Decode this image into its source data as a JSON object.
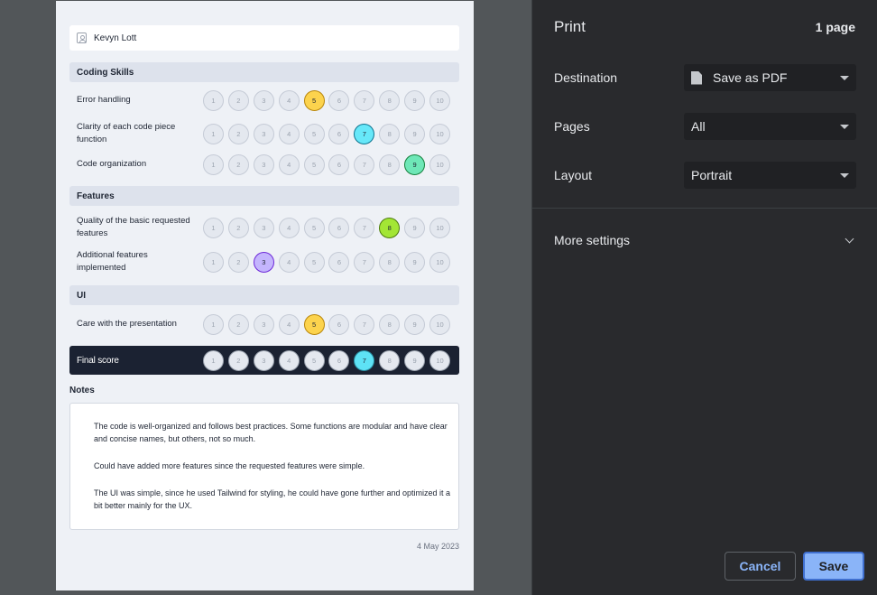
{
  "preview": {
    "candidate_name": "Kevyn Lott",
    "scale": [
      "1",
      "2",
      "3",
      "4",
      "5",
      "6",
      "7",
      "8",
      "9",
      "10"
    ],
    "sections": [
      {
        "title": "Coding Skills",
        "criteria": [
          {
            "label": "Error handling",
            "score": 5,
            "color": "#fcd34d",
            "border": "#b8860b"
          },
          {
            "label": "Clarity of each code piece function",
            "score": 7,
            "color": "#67e8f9",
            "border": "#0e7490"
          },
          {
            "label": "Code organization",
            "score": 9,
            "color": "#6ee7b7",
            "border": "#15803d"
          }
        ]
      },
      {
        "title": "Features",
        "criteria": [
          {
            "label": "Quality of the basic requested features",
            "score": 8,
            "color": "#a3e635",
            "border": "#4d7c0f"
          },
          {
            "label": "Additional features implemented",
            "score": 3,
            "color": "#c4b5fd",
            "border": "#6d28d9"
          }
        ]
      },
      {
        "title": "UI",
        "criteria": [
          {
            "label": "Care with the presentation",
            "score": 5,
            "color": "#fcd34d",
            "border": "#b8860b"
          }
        ]
      }
    ],
    "final": {
      "label": "Final score",
      "score": 7,
      "color": "#5ee2f5"
    },
    "notes_title": "Notes",
    "notes": [
      "The code is well-organized and follows best practices. Some functions are modular and have clear and concise names, but others, not so much.",
      "Could have added more features since the requested features were simple.",
      "The UI was simple, since he used Tailwind for styling, he could have gone further and optimized it a bit better mainly for the UX."
    ],
    "date": "4 May 2023"
  },
  "panel": {
    "title": "Print",
    "page_count": "1 page",
    "destination_label": "Destination",
    "destination_value": "Save as PDF",
    "destination_icon": "document-icon",
    "pages_label": "Pages",
    "pages_value": "All",
    "layout_label": "Layout",
    "layout_value": "Portrait",
    "more_settings": "More settings",
    "cancel": "Cancel",
    "save": "Save"
  }
}
